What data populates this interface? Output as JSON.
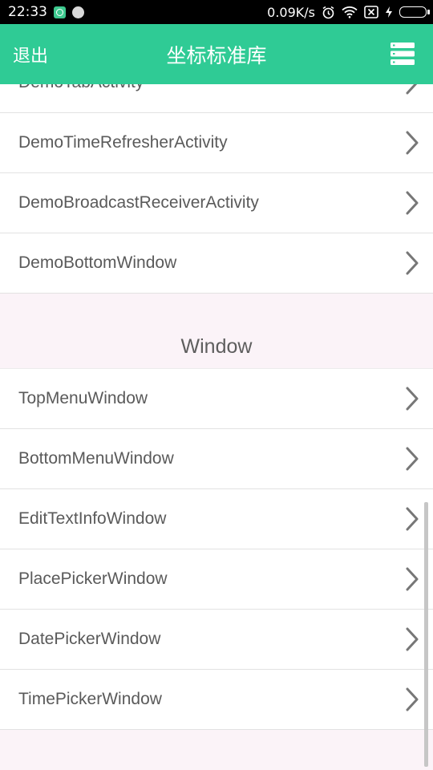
{
  "status_bar": {
    "time": "22:33",
    "speed": "0.09K/s",
    "icons": [
      "app-icon",
      "app-icon",
      "alarm-icon",
      "wifi-icon",
      "no-sim-icon",
      "charging-icon",
      "battery-icon"
    ]
  },
  "header": {
    "exit_label": "退出",
    "title": "坐标标准库",
    "menu_icon": "list-menu-icon",
    "background": "#2fcb95"
  },
  "partial_row": {
    "label": "DemoTabActivity"
  },
  "demo_rows": [
    {
      "label": "DemoTimeRefresherActivity"
    },
    {
      "label": "DemoBroadcastReceiverActivity"
    },
    {
      "label": "DemoBottomWindow"
    }
  ],
  "window_section": {
    "title": "Window",
    "rows": [
      {
        "label": "TopMenuWindow"
      },
      {
        "label": "BottomMenuWindow"
      },
      {
        "label": "EditTextInfoWindow"
      },
      {
        "label": "PlacePickerWindow"
      },
      {
        "label": "DatePickerWindow"
      },
      {
        "label": "TimePickerWindow"
      }
    ]
  }
}
